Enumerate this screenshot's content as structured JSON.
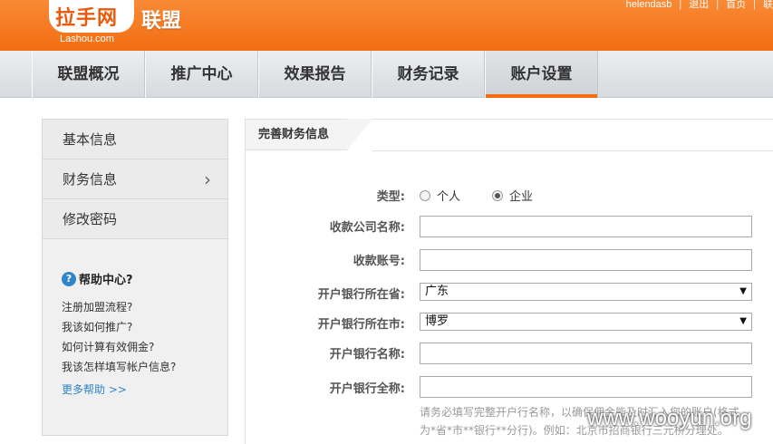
{
  "header": {
    "logo_cn": "拉手网",
    "logo_en": "Lashou.com",
    "logo_sub": "联盟",
    "top_links": [
      "helendasb",
      "退出",
      "首页",
      "联"
    ]
  },
  "nav": {
    "items": [
      {
        "label": "联盟概况"
      },
      {
        "label": "推广中心"
      },
      {
        "label": "效果报告"
      },
      {
        "label": "财务记录"
      },
      {
        "label": "账户设置",
        "active": true
      }
    ]
  },
  "sidebar": {
    "items": [
      {
        "label": "基本信息"
      },
      {
        "label": "财务信息",
        "has_arrow": true
      },
      {
        "label": "修改密码"
      }
    ],
    "help": {
      "title": "帮助中心?",
      "links": [
        "注册加盟流程?",
        "我该如何推广?",
        "如何计算有效佣金?",
        "我该怎样填写帐户信息?"
      ],
      "more": "更多帮助 >>"
    }
  },
  "form": {
    "tab_title": "完善财务信息",
    "type_label": "类型:",
    "type_options": [
      {
        "label": "个人",
        "checked": false
      },
      {
        "label": "企业",
        "checked": true
      }
    ],
    "company_name_label": "收款公司名称:",
    "company_name_value": "",
    "account_label": "收款账号:",
    "account_value": "",
    "province_label": "开户银行所在省:",
    "province_value": "广东",
    "city_label": "开户银行所在市:",
    "city_value": "博罗",
    "bank_name_label": "开户银行名称:",
    "bank_name_value": "",
    "bank_fullname_label": "开户银行全称:",
    "bank_fullname_value": "",
    "hint_line1": "请务必填写完整开户行名称，以确保佣金能及时汇入您的账户(格式",
    "hint_line2": "为*省*市**银行**分行)。例如：北京市招商银行三元桥分理处。"
  },
  "watermark": "www.wooyun.org",
  "colors": {
    "brand_orange": "#f26d12",
    "link_blue": "#2f85c9"
  }
}
